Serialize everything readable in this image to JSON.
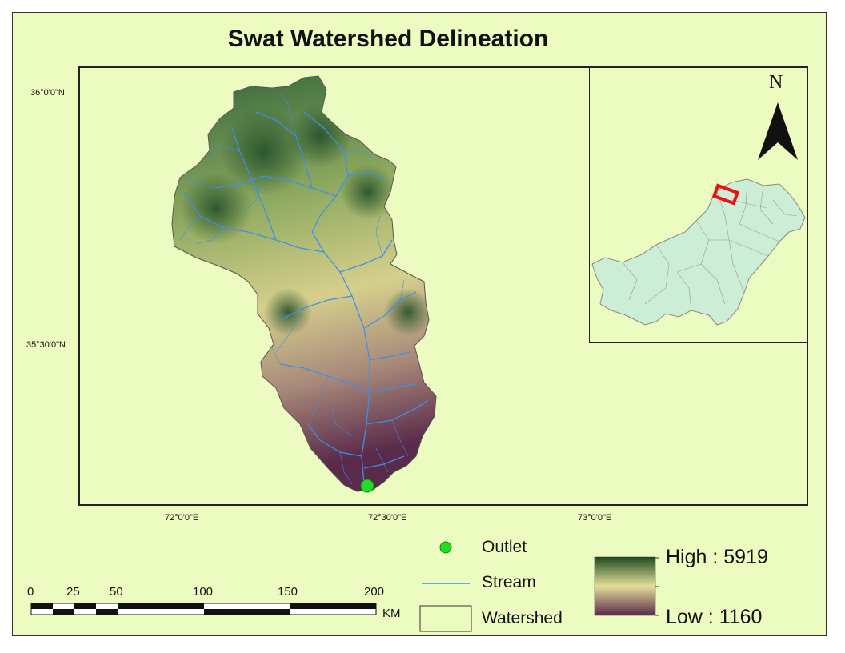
{
  "title": "Swat Watershed Delineation",
  "grid": {
    "lat_labels": [
      "36°0'0\"N",
      "35°30'0\"N"
    ],
    "lon_labels": [
      "72°0'0\"E",
      "72°30'0\"E",
      "73°0'0\"E"
    ]
  },
  "north_arrow": {
    "letter": "N",
    "icon": "north-arrow-icon"
  },
  "legend": {
    "outlet_label": "Outlet",
    "stream_label": "Stream",
    "watershed_label": "Watershed",
    "elevation_high": "High : 5919",
    "elevation_low": "Low : 1160"
  },
  "scale_bar": {
    "ticks": [
      "0",
      "25",
      "50",
      "100",
      "150",
      "200"
    ],
    "unit": "KM"
  },
  "colors": {
    "background": "#ecfcc0",
    "stream": "#3f8fe8",
    "outlet": "#22dd22",
    "ramp_high": "#1f4a1e",
    "ramp_mid": "#e3df9a",
    "ramp_low": "#5a2a4a",
    "inset_country": "#cdeed6",
    "inset_highlight": "#ee1111"
  }
}
